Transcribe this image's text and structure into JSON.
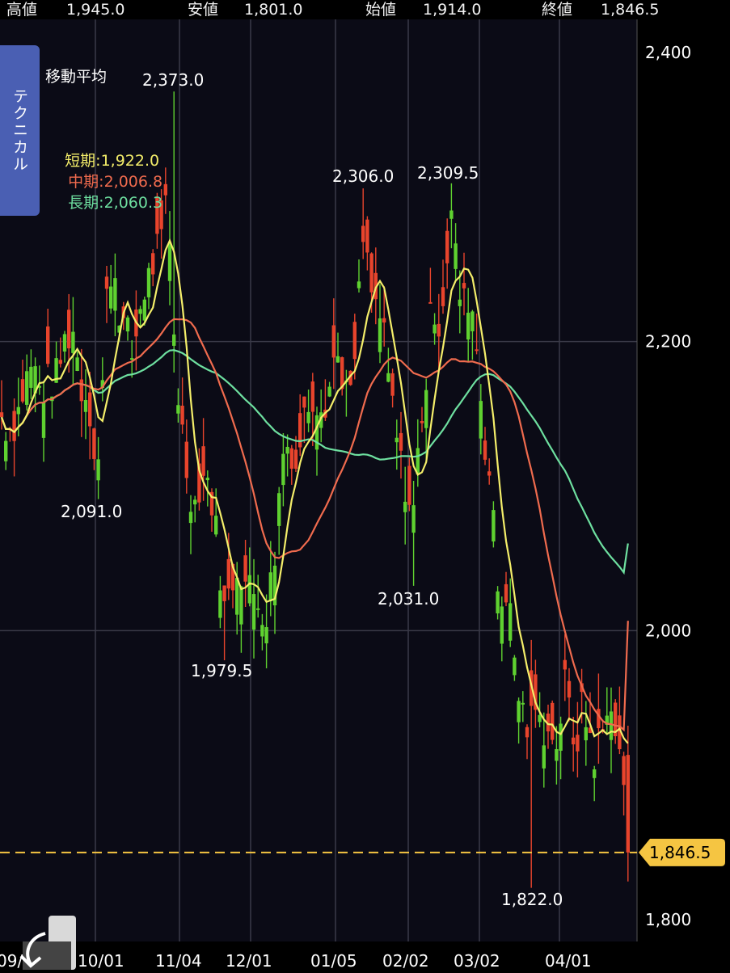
{
  "header": {
    "high_label": "高値",
    "high_value": "1,945.0",
    "low_label": "安値",
    "low_value": "1,801.0",
    "open_label": "始値",
    "open_value": "1,914.0",
    "close_label": "終値",
    "close_value": "1,846.5"
  },
  "moving_average": {
    "title": "移動平均",
    "short": "短期:1,922.0",
    "mid": "中期:2,006.8",
    "long": "長期:2,060.3",
    "colors": {
      "short": "#f4ee6a",
      "mid": "#f06b4e",
      "long": "#6ee0a0"
    }
  },
  "technical_tab": {
    "label": "テクニカル",
    "icon": "side-tab"
  },
  "back_button": {
    "icon": "back-arrow-icon"
  },
  "chart_data": {
    "type": "candlestick",
    "ylim": [
      1800,
      2400
    ],
    "y_ticks": [
      "2,400",
      "2,200",
      "2,000",
      "1,800"
    ],
    "x_ticks": [
      "09/",
      "10/01",
      "11/04",
      "12/01",
      "01/05",
      "02/02",
      "03/02",
      "04/01"
    ],
    "current_price": "1,846.5",
    "colors": {
      "up": "#5fd130",
      "down": "#e8442c",
      "grid": "#3a3a48",
      "current": "#f5c542"
    },
    "annotations": [
      {
        "label": "2,373.0",
        "value": 2373.0
      },
      {
        "label": "2,306.0",
        "value": 2306.0
      },
      {
        "label": "2,309.5",
        "value": 2309.5
      },
      {
        "label": "2,091.0",
        "value": 2091.0
      },
      {
        "label": "1,979.5",
        "value": 1979.5
      },
      {
        "label": "2,031.0",
        "value": 2031.0
      },
      {
        "label": "1,822.0",
        "value": 1822.0
      }
    ],
    "close_keypoints": [
      [
        0,
        2150
      ],
      [
        10,
        2140
      ],
      [
        20,
        2145
      ],
      [
        30,
        2170
      ],
      [
        40,
        2185
      ],
      [
        50,
        2165
      ],
      [
        60,
        2172
      ],
      [
        70,
        2175
      ],
      [
        80,
        2200
      ],
      [
        90,
        2210
      ],
      [
        100,
        2170
      ],
      [
        110,
        2160
      ],
      [
        115,
        2135
      ],
      [
        120,
        2105
      ],
      [
        125,
        2150
      ],
      [
        133,
        2240
      ],
      [
        140,
        2255
      ],
      [
        150,
        2215
      ],
      [
        160,
        2200
      ],
      [
        165,
        2185
      ],
      [
        170,
        2215
      ],
      [
        178,
        2235
      ],
      [
        185,
        2245
      ],
      [
        195,
        2265
      ],
      [
        200,
        2265
      ],
      [
        205,
        2295
      ],
      [
        212,
        2255
      ],
      [
        217,
        2185
      ],
      [
        222,
        2155
      ],
      [
        230,
        2115
      ],
      [
        240,
        2085
      ],
      [
        250,
        2110
      ],
      [
        260,
        2100
      ],
      [
        270,
        2055
      ],
      [
        278,
        2012
      ],
      [
        285,
        2030
      ],
      [
        295,
        2050
      ],
      [
        305,
        2030
      ],
      [
        315,
        2025
      ],
      [
        322,
        2020
      ],
      [
        330,
        2010
      ],
      [
        340,
        2055
      ],
      [
        350,
        2125
      ],
      [
        360,
        2130
      ],
      [
        365,
        2110
      ],
      [
        375,
        2145
      ],
      [
        385,
        2165
      ],
      [
        395,
        2160
      ],
      [
        405,
        2162
      ],
      [
        415,
        2195
      ],
      [
        425,
        2175
      ],
      [
        435,
        2155
      ],
      [
        440,
        2200
      ],
      [
        450,
        2275
      ],
      [
        458,
        2235
      ],
      [
        465,
        2225
      ],
      [
        472,
        2215
      ],
      [
        480,
        2175
      ],
      [
        487,
        2150
      ],
      [
        495,
        2115
      ],
      [
        505,
        2095
      ],
      [
        510,
        2070
      ],
      [
        520,
        2145
      ],
      [
        528,
        2175
      ],
      [
        535,
        2235
      ],
      [
        542,
        2210
      ],
      [
        550,
        2240
      ],
      [
        558,
        2290
      ],
      [
        565,
        2250
      ],
      [
        572,
        2220
      ],
      [
        578,
        2235
      ],
      [
        585,
        2220
      ],
      [
        592,
        2185
      ],
      [
        598,
        2140
      ],
      [
        605,
        2110
      ],
      [
        612,
        2060
      ],
      [
        618,
        2010
      ],
      [
        625,
        2035
      ],
      [
        632,
        2005
      ],
      [
        640,
        1960
      ],
      [
        648,
        1940
      ],
      [
        655,
        1930
      ],
      [
        662,
        1950
      ],
      [
        670,
        1925
      ],
      [
        677,
        1945
      ],
      [
        685,
        1915
      ],
      [
        692,
        1935
      ],
      [
        700,
        1965
      ],
      [
        705,
        1940
      ],
      [
        712,
        1920
      ],
      [
        720,
        1945
      ],
      [
        727,
        1935
      ],
      [
        735,
        1915
      ],
      [
        742,
        1925
      ],
      [
        750,
        1935
      ],
      [
        757,
        1960
      ],
      [
        762,
        1925
      ],
      [
        768,
        1905
      ],
      [
        775,
        1885
      ],
      [
        782,
        1846.5
      ]
    ],
    "wick_peaks": [
      [
        217,
        2373.0
      ],
      [
        450,
        2306.0
      ],
      [
        558,
        2309.5
      ],
      [
        120,
        2091.0
      ],
      [
        276,
        1979.5
      ],
      [
        510,
        2031.0
      ],
      [
        658,
        1822.0
      ],
      [
        782,
        1801.0
      ]
    ]
  }
}
